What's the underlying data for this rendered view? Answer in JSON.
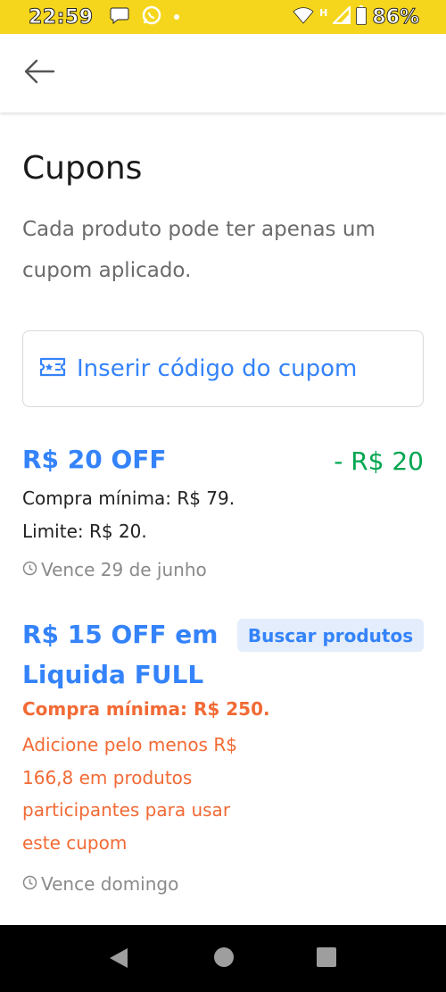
{
  "status_bar": {
    "time": "22:59",
    "battery": "86%",
    "icons": [
      "chat-bubble-icon",
      "whatsapp-icon",
      "notification-dot",
      "wifi-icon",
      "h-network-icon",
      "signal-icon",
      "battery-icon"
    ]
  },
  "nav": {
    "back_icon": "arrow-left-icon"
  },
  "page": {
    "title": "Cupons",
    "subtitle": "Cada produto pode ter apenas um cupom aplicado."
  },
  "coupon_input": {
    "icon": "coupon-ticket-icon",
    "label": "Inserir código do cupom"
  },
  "coupons": [
    {
      "title": "R$ 20 OFF",
      "discount": "- R$ 20",
      "min_purchase": "Compra mínima: R$ 79.",
      "limit": "Limite: R$ 20.",
      "expiry": "Vence 29 de junho"
    },
    {
      "title": "R$ 15 OFF em Liquida FULL",
      "button": "Buscar produtos",
      "min_purchase": "Compra mínima: R$ 250.",
      "note": "Adicione pelo menos R$ 166,8 em produtos participantes para usar este cupom",
      "expiry": "Vence domingo"
    }
  ],
  "colors": {
    "status_bar": "#f5d61c",
    "accent_blue": "#3483fa",
    "discount_green": "#00a650",
    "warning_orange": "#f26a35"
  }
}
